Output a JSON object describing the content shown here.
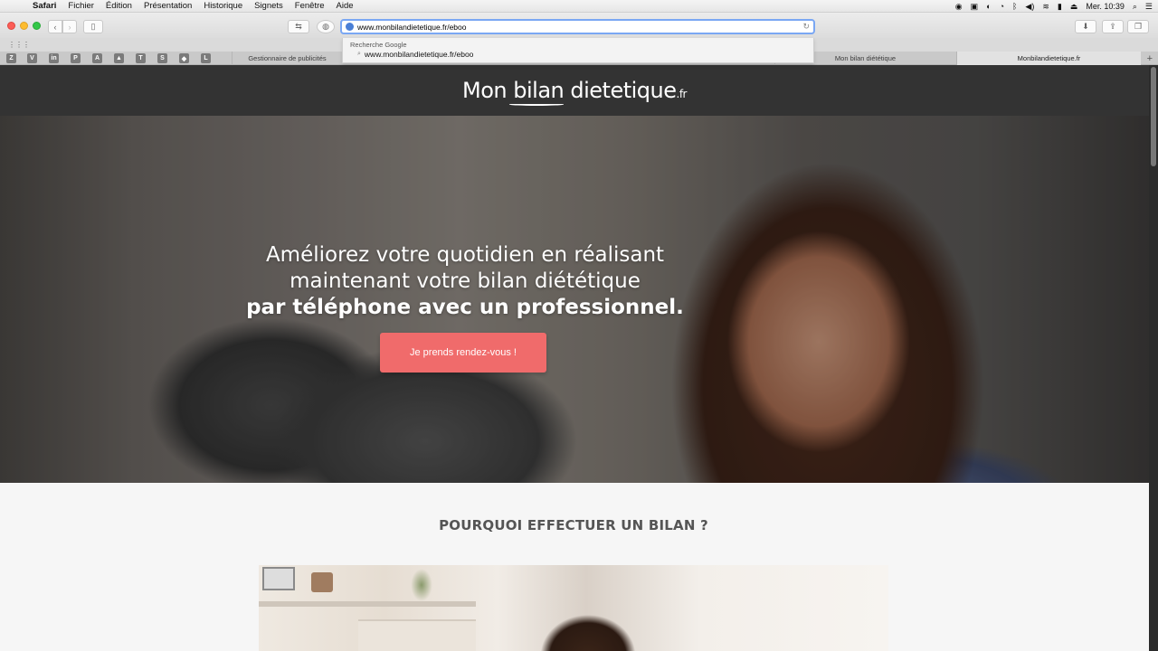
{
  "menubar": {
    "app_name": "Safari",
    "items": [
      "Fichier",
      "Édition",
      "Présentation",
      "Historique",
      "Signets",
      "Fenêtre",
      "Aide"
    ],
    "clock": "Mer. 10:39"
  },
  "browser": {
    "address": "www.monbilandietetique.fr/eboo",
    "autocomplete_heading": "Recherche Google",
    "autocomplete_suggestion": "www.monbilandietetique.fr/eboo",
    "bookmark_favicons": [
      "Z",
      "V",
      "in",
      "P",
      "A",
      "▲",
      "T",
      "S",
      "◆",
      "L"
    ],
    "tabs": [
      "Gestionnaire de publicités",
      "Mon bilan diététique",
      "Monbilandietetique.fr"
    ]
  },
  "site": {
    "logo_main": "Mon bilan dietetique",
    "logo_tld": ".fr",
    "hero_line1": "Améliorez votre quotidien en réalisant",
    "hero_line2": "maintenant votre bilan diététique",
    "hero_line3_start": "par téléphone avec un ",
    "hero_line3_bold": "professionnel.",
    "cta_label": "Je prends rendez-vous !",
    "section_title": "POURQUOI EFFECTUER UN BILAN ?"
  }
}
